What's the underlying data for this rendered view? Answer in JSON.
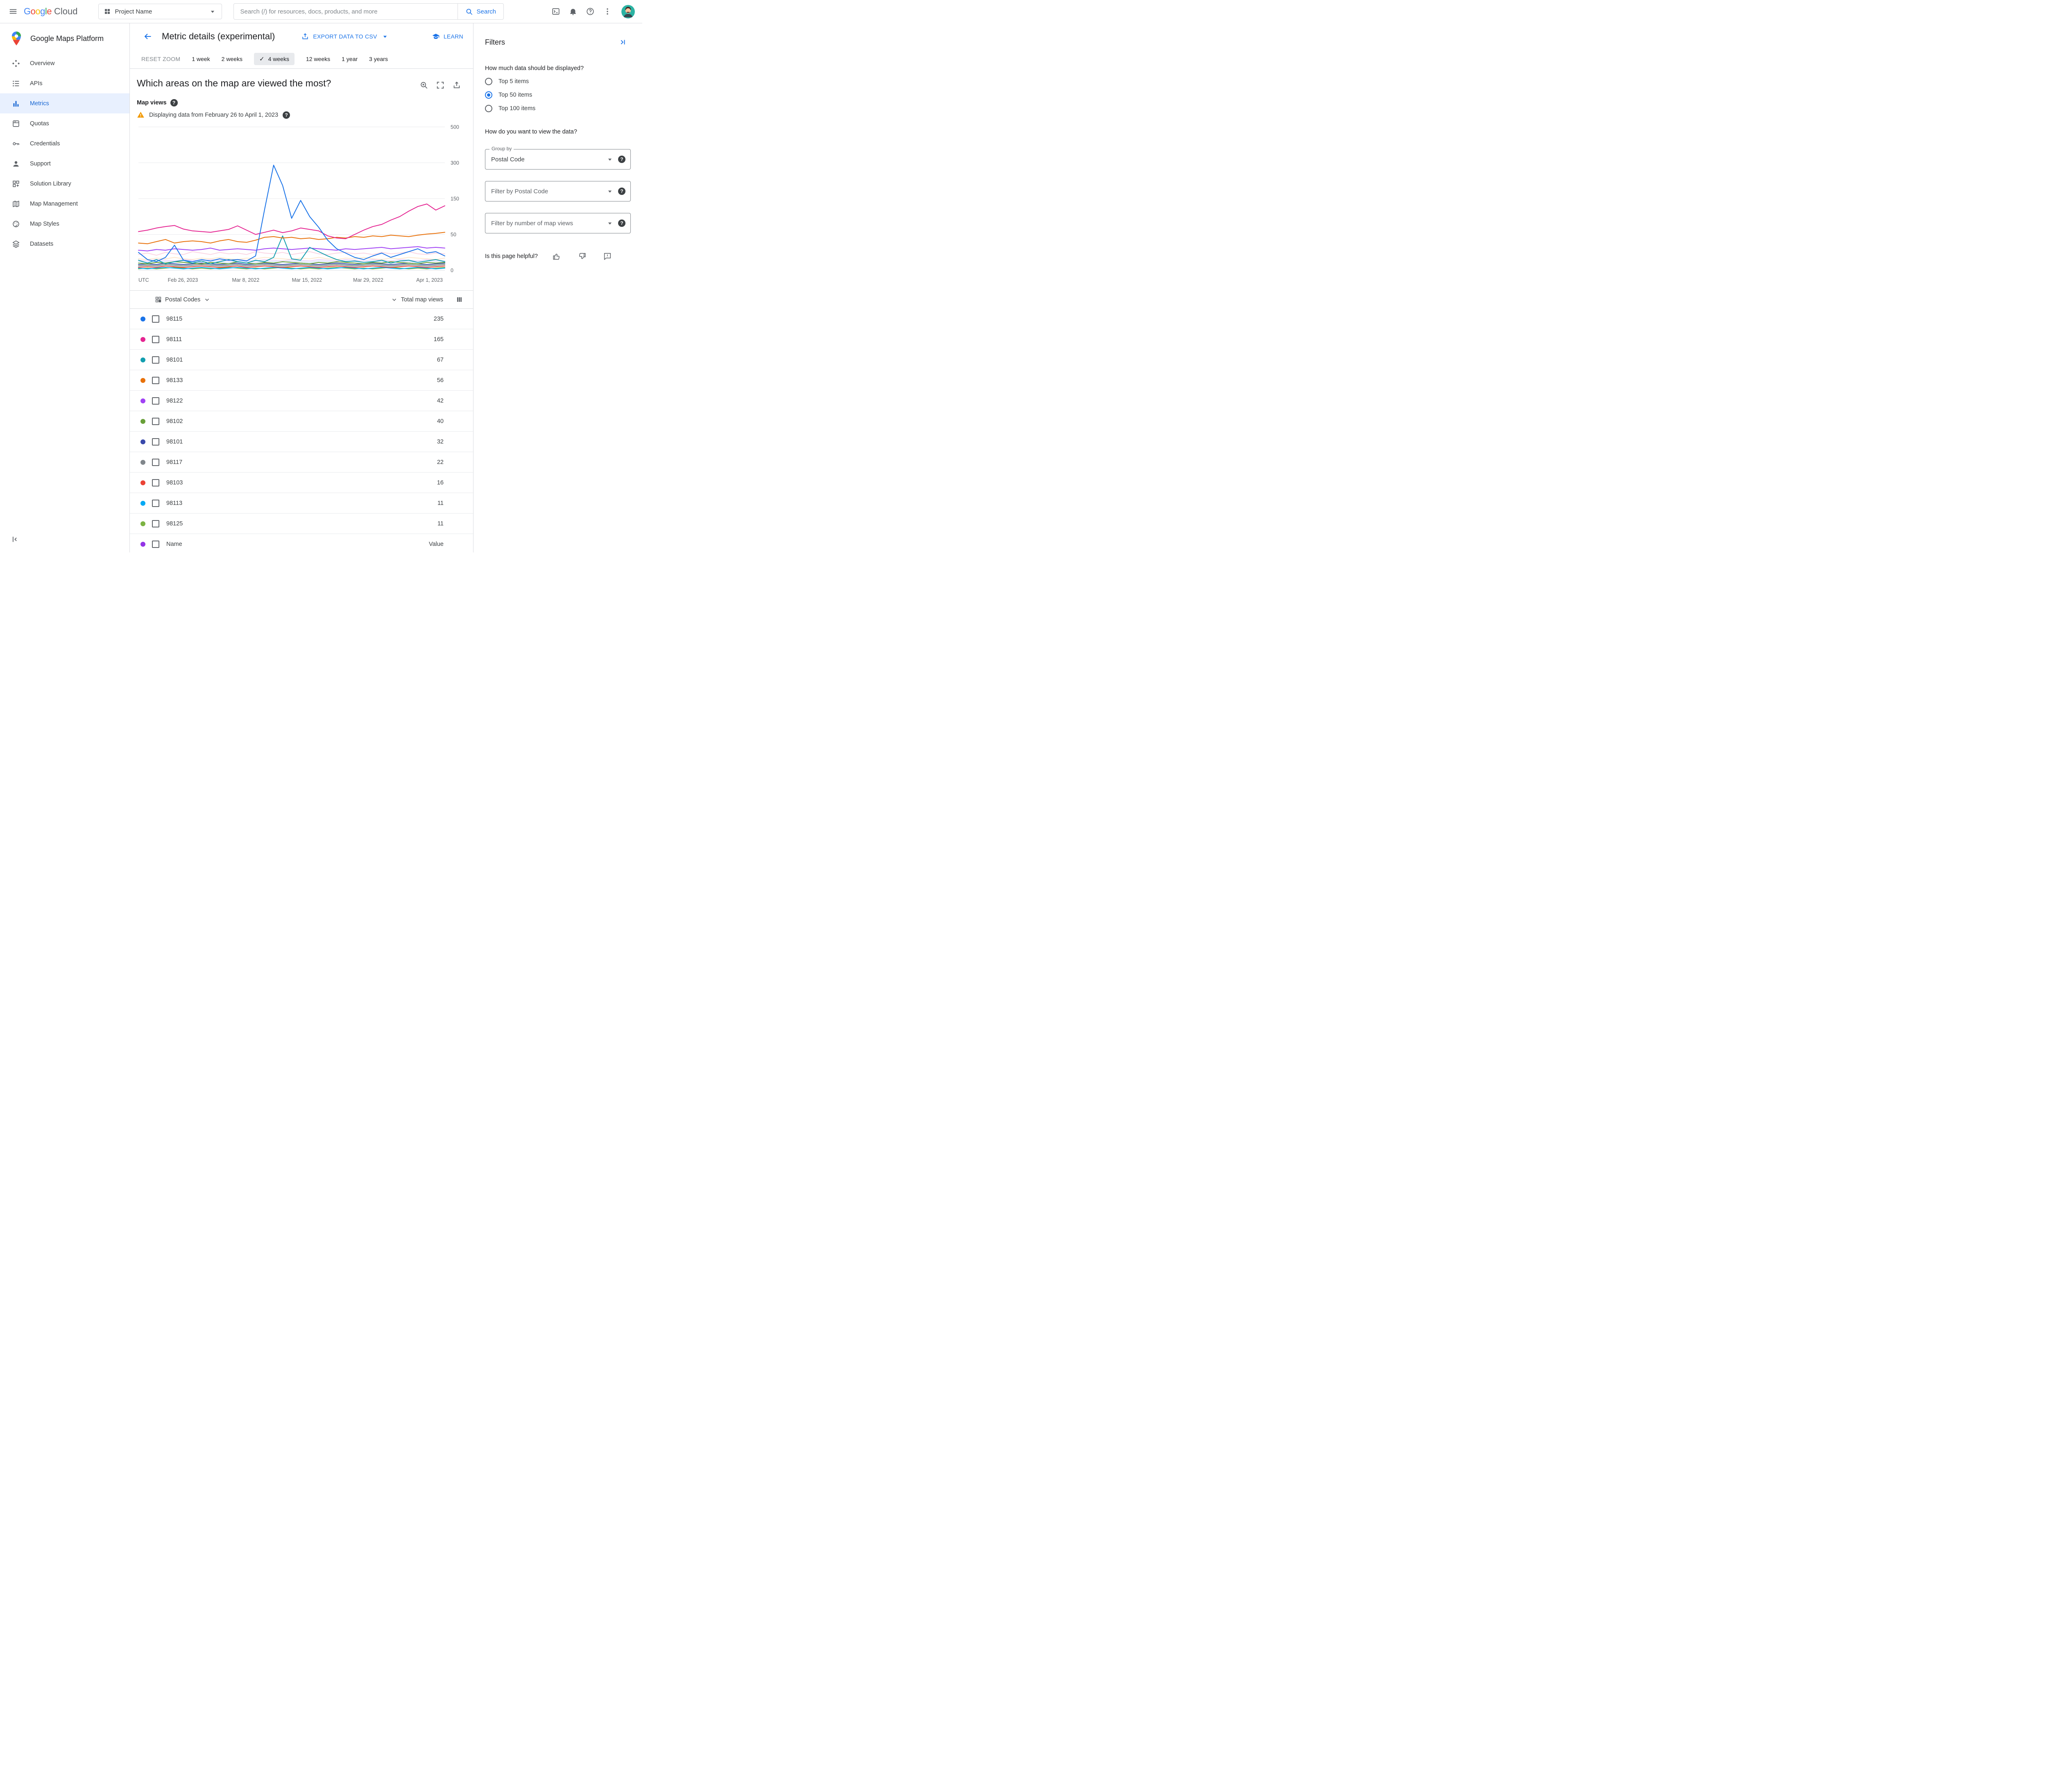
{
  "topbar": {
    "logo_google": "Google",
    "logo_cloud": "Cloud",
    "project_selector_label": "Project Name",
    "search_placeholder": "Search (/) for resources, docs, products, and more",
    "search_button_label": "Search"
  },
  "sidebar": {
    "title": "Google Maps Platform",
    "items": [
      {
        "icon": "overview-icon",
        "label": "Overview",
        "active": false
      },
      {
        "icon": "apis-icon",
        "label": "APIs",
        "active": false
      },
      {
        "icon": "metrics-icon",
        "label": "Metrics",
        "active": true
      },
      {
        "icon": "quotas-icon",
        "label": "Quotas",
        "active": false
      },
      {
        "icon": "credentials-icon",
        "label": "Credentials",
        "active": false
      },
      {
        "icon": "support-icon",
        "label": "Support",
        "active": false
      },
      {
        "icon": "solution-library-icon",
        "label": "Solution Library",
        "active": false
      },
      {
        "icon": "map-management-icon",
        "label": "Map Management",
        "active": false
      },
      {
        "icon": "map-styles-icon",
        "label": "Map Styles",
        "active": false
      },
      {
        "icon": "datasets-icon",
        "label": "Datasets",
        "active": false
      }
    ]
  },
  "page_header": {
    "title": "Metric details (experimental)",
    "export_label": "EXPORT DATA TO CSV",
    "learn_label": "LEARN"
  },
  "time_controls": {
    "reset_label": "RESET ZOOM",
    "ranges": [
      "1 week",
      "2 weeks",
      "4 weeks",
      "12 weeks",
      "1 year",
      "3 years"
    ],
    "selected": "4 weeks"
  },
  "metric_section": {
    "question": "Which areas on the map are viewed the most?",
    "metric_label": "Map views",
    "warning_text": "Displaying data from February 26 to April 1, 2023"
  },
  "chart_data": {
    "type": "line",
    "title": "Which areas on the map are viewed the most?",
    "metric": "Map views",
    "timezone_label": "UTC",
    "y_ticks": [
      0,
      50,
      150,
      300,
      500
    ],
    "x_tick_labels": [
      "Feb 26, 2023",
      "Mar 8, 2022",
      "Mar 15, 2022",
      "Mar 29, 2022",
      "Apr 1, 2023"
    ],
    "x_tick_fractions": [
      0.145,
      0.35,
      0.55,
      0.75,
      0.95
    ],
    "grid": true,
    "legend": "none",
    "series": [
      {
        "name": "98125",
        "color": "#7cb342",
        "values": [
          2,
          3,
          2,
          3,
          4,
          3,
          2,
          3,
          2,
          3,
          4,
          3,
          2,
          3,
          2,
          3,
          4,
          3,
          2,
          3,
          2,
          3,
          4,
          3,
          2,
          3,
          2,
          3,
          4,
          3,
          2,
          3,
          2,
          3,
          4
        ]
      },
      {
        "name": "98113",
        "color": "#03a9f4",
        "values": [
          3,
          2,
          3,
          4,
          3,
          2,
          3,
          4,
          3,
          2,
          3,
          4,
          3,
          2,
          3,
          4,
          3,
          2,
          3,
          4,
          3,
          2,
          3,
          4,
          3,
          2,
          3,
          4,
          3,
          2,
          3,
          4,
          3,
          2,
          3
        ]
      },
      {
        "name": "98103",
        "color": "#ea4335",
        "values": [
          4,
          5,
          4,
          6,
          5,
          4,
          5,
          6,
          5,
          4,
          5,
          6,
          4,
          5,
          6,
          5,
          4,
          5,
          6,
          5,
          4,
          5,
          6,
          5,
          4,
          5,
          6,
          5,
          4,
          5,
          6,
          5,
          4,
          5,
          6
        ]
      },
      {
        "name": "98117",
        "color": "#80868b",
        "values": [
          6,
          7,
          6,
          8,
          7,
          6,
          7,
          8,
          7,
          6,
          7,
          8,
          6,
          7,
          8,
          7,
          6,
          7,
          8,
          7,
          6,
          7,
          8,
          7,
          6,
          7,
          8,
          7,
          6,
          7,
          8,
          7,
          6,
          7,
          8
        ]
      },
      {
        "name": "98101-b",
        "color": "#3949ab",
        "values": [
          8,
          9,
          8,
          10,
          9,
          8,
          9,
          10,
          9,
          8,
          9,
          10,
          8,
          9,
          10,
          9,
          8,
          9,
          10,
          9,
          8,
          9,
          10,
          9,
          8,
          9,
          10,
          9,
          8,
          9,
          10,
          9,
          8,
          9,
          10
        ]
      },
      {
        "name": "98102",
        "color": "#689f38",
        "values": [
          10,
          9,
          11,
          10,
          12,
          11,
          10,
          9,
          11,
          10,
          9,
          12,
          10,
          9,
          11,
          10,
          12,
          11,
          10,
          9,
          11,
          10,
          12,
          11,
          10,
          9,
          11,
          10,
          12,
          11,
          10,
          9,
          11,
          10,
          11
        ]
      },
      {
        "name": "98122",
        "color": "#a142f4",
        "values": [
          28,
          27,
          29,
          28,
          30,
          29,
          28,
          29,
          31,
          28,
          29,
          30,
          29,
          28,
          30,
          31,
          30,
          29,
          30,
          31,
          30,
          29,
          28,
          30,
          29,
          30,
          31,
          32,
          30,
          31,
          32,
          33,
          31,
          32,
          31
        ]
      },
      {
        "name": "98101",
        "color": "#129eaf",
        "values": [
          14,
          10,
          15,
          9,
          12,
          14,
          10,
          13,
          9,
          12,
          15,
          12,
          10,
          14,
          12,
          18,
          48,
          16,
          14,
          32,
          26,
          20,
          15,
          12,
          13,
          11,
          12,
          14,
          10,
          13,
          14,
          11,
          13,
          15,
          12
        ]
      },
      {
        "name": "98133",
        "color": "#e8710a",
        "values": [
          38,
          37,
          40,
          43,
          38,
          40,
          41,
          40,
          38,
          41,
          43,
          40,
          39,
          42,
          46,
          47,
          45,
          46,
          44,
          45,
          43,
          44,
          46,
          45,
          47,
          46,
          48,
          47,
          49,
          48,
          47,
          49,
          51,
          53,
          56
        ]
      },
      {
        "name": "98111",
        "color": "#e52592",
        "values": [
          58,
          62,
          68,
          72,
          75,
          65,
          60,
          58,
          56,
          60,
          64,
          74,
          62,
          50,
          56,
          62,
          55,
          60,
          68,
          64,
          60,
          48,
          45,
          44,
          50,
          62,
          72,
          78,
          90,
          100,
          115,
          128,
          135,
          118,
          130
        ]
      },
      {
        "name": "98115",
        "color": "#1a73e8",
        "values": [
          25,
          15,
          12,
          18,
          35,
          14,
          12,
          15,
          13,
          16,
          14,
          15,
          13,
          20,
          120,
          290,
          205,
          95,
          145,
          100,
          70,
          42,
          30,
          24,
          18,
          15,
          20,
          24,
          18,
          22,
          26,
          30,
          24,
          26,
          20
        ]
      }
    ],
    "muted_series": [
      {
        "color": "#f8b5ce",
        "values": [
          22,
          24,
          21,
          25,
          23,
          22,
          26,
          24,
          22,
          25,
          23,
          24,
          22,
          26,
          24,
          23,
          25,
          22,
          24,
          26,
          23,
          22,
          24,
          25,
          23,
          24,
          22,
          25,
          23,
          24,
          26,
          23,
          22,
          24,
          23
        ]
      },
      {
        "color": "#fdd6a8",
        "values": [
          16,
          15,
          17,
          16,
          18,
          16,
          15,
          17,
          16,
          18,
          16,
          15,
          17,
          16,
          18,
          17,
          16,
          15,
          17,
          16,
          18,
          16,
          15,
          17,
          16,
          18,
          16,
          15,
          17,
          16,
          18,
          17,
          16,
          15,
          17
        ]
      },
      {
        "color": "#aecbfa",
        "values": [
          12,
          11,
          13,
          12,
          11,
          13,
          12,
          11,
          13,
          12,
          11,
          13,
          12,
          11,
          13,
          12,
          11,
          13,
          12,
          11,
          13,
          12,
          11,
          13,
          12,
          11,
          13,
          12,
          11,
          13,
          12,
          11,
          13,
          12,
          11
        ]
      },
      {
        "color": "#d7aefb",
        "values": [
          14,
          13,
          15,
          14,
          13,
          15,
          14,
          13,
          15,
          14,
          13,
          15,
          14,
          13,
          15,
          14,
          13,
          15,
          14,
          13,
          15,
          14,
          13,
          15,
          14,
          13,
          15,
          14,
          13,
          15,
          14,
          13,
          15,
          14,
          13
        ]
      },
      {
        "color": "#a8dab5",
        "values": [
          7,
          8,
          7,
          9,
          8,
          7,
          8,
          9,
          8,
          7,
          8,
          9,
          7,
          8,
          9,
          8,
          7,
          8,
          9,
          8,
          7,
          8,
          9,
          8,
          7,
          8,
          9,
          8,
          7,
          8,
          9,
          8,
          7,
          8,
          9
        ]
      },
      {
        "color": "#cbf0f8",
        "values": [
          5,
          6,
          5,
          7,
          6,
          5,
          6,
          7,
          6,
          5,
          6,
          7,
          5,
          6,
          7,
          6,
          5,
          6,
          7,
          6,
          5,
          6,
          7,
          6,
          5,
          6,
          7,
          6,
          5,
          6,
          7,
          6,
          5,
          6,
          7
        ]
      }
    ]
  },
  "table": {
    "group_header": "Postal Codes",
    "value_header": "Total map views",
    "rows": [
      {
        "code": "98115",
        "value": "235",
        "color": "#1a73e8"
      },
      {
        "code": "98111",
        "value": "165",
        "color": "#e52592"
      },
      {
        "code": "98101",
        "value": "67",
        "color": "#129eaf"
      },
      {
        "code": "98133",
        "value": "56",
        "color": "#e8710a"
      },
      {
        "code": "98122",
        "value": "42",
        "color": "#a142f4"
      },
      {
        "code": "98102",
        "value": "40",
        "color": "#689f38"
      },
      {
        "code": "98101",
        "value": "32",
        "color": "#3949ab"
      },
      {
        "code": "98117",
        "value": "22",
        "color": "#80868b"
      },
      {
        "code": "98103",
        "value": "16",
        "color": "#ea4335"
      },
      {
        "code": "98113",
        "value": "11",
        "color": "#03a9f4"
      },
      {
        "code": "98125",
        "value": "11",
        "color": "#7cb342"
      },
      {
        "code": "Name",
        "value": "Value",
        "color": "#9334e6"
      }
    ]
  },
  "filters": {
    "title": "Filters",
    "amount_question": "How much data should be displayed?",
    "amount_options": [
      "Top 5 items",
      "Top 50 items",
      "Top 100 items"
    ],
    "amount_selected": "Top 50 items",
    "view_question": "How do you want to view the data?",
    "group_by_label": "Group by",
    "group_by_value": "Postal Code",
    "postal_filter_placeholder": "Filter by Postal Code",
    "views_filter_placeholder": "Filter by number of map views",
    "helpful_question": "Is this page helpful?"
  }
}
